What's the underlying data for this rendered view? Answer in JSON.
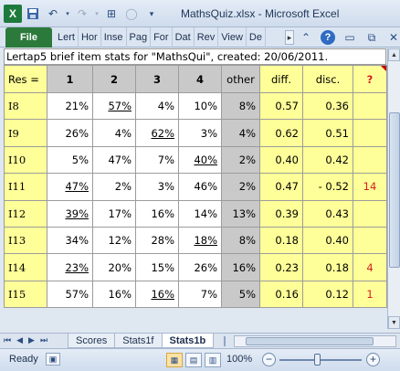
{
  "window": {
    "title": "MathsQuiz.xlsx - Microsoft Excel",
    "app_icon": "X",
    "qat": {
      "save_icon": "save-icon",
      "undo_icon": "undo-icon",
      "redo_icon": "redo-icon",
      "customize_icon": "dropdown-icon"
    }
  },
  "ribbon": {
    "file_label": "File",
    "tabs": [
      "Lert",
      "Hor",
      "Inse",
      "Pag",
      "For",
      "Dat",
      "Rev",
      "View",
      "De"
    ],
    "more_label": "▸"
  },
  "sheet": {
    "header_line": "Lertap5 brief item stats for \"MathsQui\", created: 20/06/2011.",
    "columns": [
      "Res =",
      "1",
      "2",
      "3",
      "4",
      "other",
      "diff.",
      "disc.",
      "?"
    ],
    "rows": [
      {
        "item": "I8",
        "r1": "21%",
        "r2": "57%",
        "r3": "4%",
        "r4": "10%",
        "other": "8%",
        "diff": "0.57",
        "disc": "0.36",
        "q": "",
        "ul": 2
      },
      {
        "item": "I9",
        "r1": "26%",
        "r2": "4%",
        "r3": "62%",
        "r4": "3%",
        "other": "4%",
        "diff": "0.62",
        "disc": "0.51",
        "q": "",
        "ul": 3
      },
      {
        "item": "I10",
        "r1": "5%",
        "r2": "47%",
        "r3": "7%",
        "r4": "40%",
        "other": "2%",
        "diff": "0.40",
        "disc": "0.42",
        "q": "",
        "ul": 4
      },
      {
        "item": "I11",
        "r1": "47%",
        "r2": "2%",
        "r3": "3%",
        "r4": "46%",
        "other": "2%",
        "diff": "0.47",
        "disc": "- 0.52",
        "q": "14",
        "ul": 1
      },
      {
        "item": "I12",
        "r1": "39%",
        "r2": "17%",
        "r3": "16%",
        "r4": "14%",
        "other": "13%",
        "diff": "0.39",
        "disc": "0.43",
        "q": "",
        "ul": 1
      },
      {
        "item": "I13",
        "r1": "34%",
        "r2": "12%",
        "r3": "28%",
        "r4": "18%",
        "other": "8%",
        "diff": "0.18",
        "disc": "0.40",
        "q": "",
        "ul": 4
      },
      {
        "item": "I14",
        "r1": "23%",
        "r2": "20%",
        "r3": "15%",
        "r4": "26%",
        "other": "16%",
        "diff": "0.23",
        "disc": "0.18",
        "q": "4",
        "ul": 1
      },
      {
        "item": "I15",
        "r1": "57%",
        "r2": "16%",
        "r3": "16%",
        "r4": "7%",
        "other": "5%",
        "diff": "0.16",
        "disc": "0.12",
        "q": "1",
        "ul": 3
      }
    ]
  },
  "sheet_tabs": [
    "Scores",
    "Stats1f",
    "Stats1b"
  ],
  "active_sheet": "Stats1b",
  "status": {
    "ready": "Ready",
    "zoom": "100%"
  },
  "colors": {
    "file_tab": "#2b7a3c",
    "header_yellow": "#ffff99",
    "gray": "#c9c9c9",
    "red_flag": "#d42020"
  }
}
